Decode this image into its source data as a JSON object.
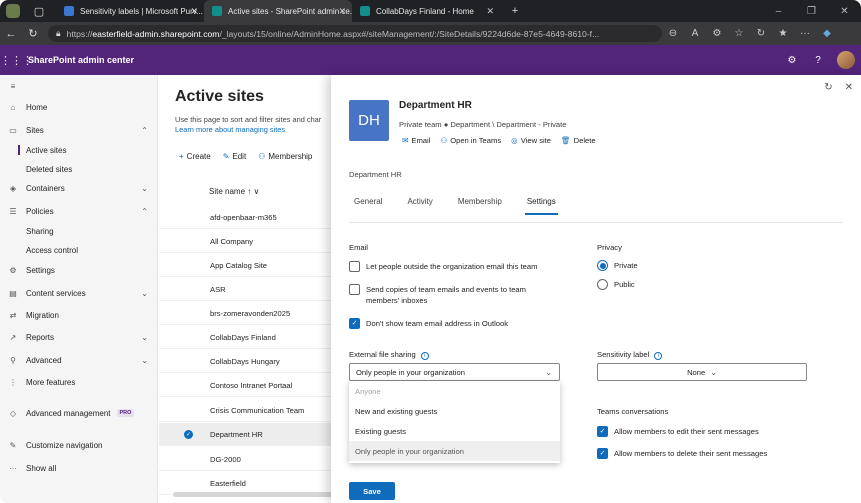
{
  "browser": {
    "tabs": [
      {
        "title": "Sensitivity labels | Microsoft Purv..."
      },
      {
        "title": "Active sites - SharePoint admin ce..."
      },
      {
        "title": "CollabDays Finland - Home"
      }
    ],
    "url_host": "easterfield-admin.sharepoint.com",
    "url_prefix": "https://",
    "url_path": "/_layouts/15/online/AdminHome.aspx#/siteManagement/:/SiteDetails/9224d6de-87e5-4649-8610-f...",
    "ext_label": "···"
  },
  "suite": {
    "title": "SharePoint admin center"
  },
  "nav": {
    "home": "Home",
    "sites": "Sites",
    "active_sites": "Active sites",
    "deleted_sites": "Deleted sites",
    "containers": "Containers",
    "policies": "Policies",
    "sharing": "Sharing",
    "access_control": "Access control",
    "settings": "Settings",
    "content_services": "Content services",
    "migration": "Migration",
    "reports": "Reports",
    "advanced": "Advanced",
    "more_features": "More features",
    "advanced_management": "Advanced management",
    "pro_badge": "PRO",
    "customize_navigation": "Customize navigation",
    "show_all": "Show all"
  },
  "main": {
    "title": "Active sites",
    "desc": "Use this page to sort and filter sites and char",
    "learn_more": "Learn more about managing sites",
    "commands": {
      "create": "Create",
      "edit": "Edit",
      "membership": "Membership"
    },
    "col_site_name": "Site name ↑ ∨",
    "sites": [
      "afd-openbaar-m365",
      "All Company",
      "App Catalog Site",
      "ASR",
      "brs-zomeravonden2025",
      "CollabDays Finland",
      "CollabDays Hungary",
      "Contoso Intranet Portaal",
      "Crisis Communication Team",
      "Department HR",
      "DG-2000",
      "Easterfield"
    ]
  },
  "panel": {
    "tile": "DH",
    "title": "Department HR",
    "subtitle": "Private team  ●  Department \\ Department - Private",
    "actions": {
      "email": "Email",
      "open_teams": "Open in Teams",
      "view_site": "View site",
      "delete": "Delete"
    },
    "breadcrumb": "Department HR",
    "tabs": [
      "General",
      "Activity",
      "Membership",
      "Settings"
    ],
    "email_heading": "Email",
    "email_opt1": "Let people outside the organization email this team",
    "email_opt2": "Send copies of team emails and events to team members' inboxes",
    "email_opt3": "Don't show team email address in Outlook",
    "privacy_heading": "Privacy",
    "privacy_private": "Private",
    "privacy_public": "Public",
    "ext_sharing_heading": "External file sharing",
    "ext_sharing_value": "Only people in your organization",
    "ext_sharing_options": [
      "Anyone",
      "New and existing guests",
      "Existing guests",
      "Only people in your organization"
    ],
    "sensitivity_heading": "Sensitivity label",
    "sensitivity_value": "None",
    "teams_heading": "Teams conversations",
    "teams_opt1": "Allow members to edit their sent messages",
    "teams_opt2": "Allow members to delete their sent messages",
    "save": "Save"
  }
}
